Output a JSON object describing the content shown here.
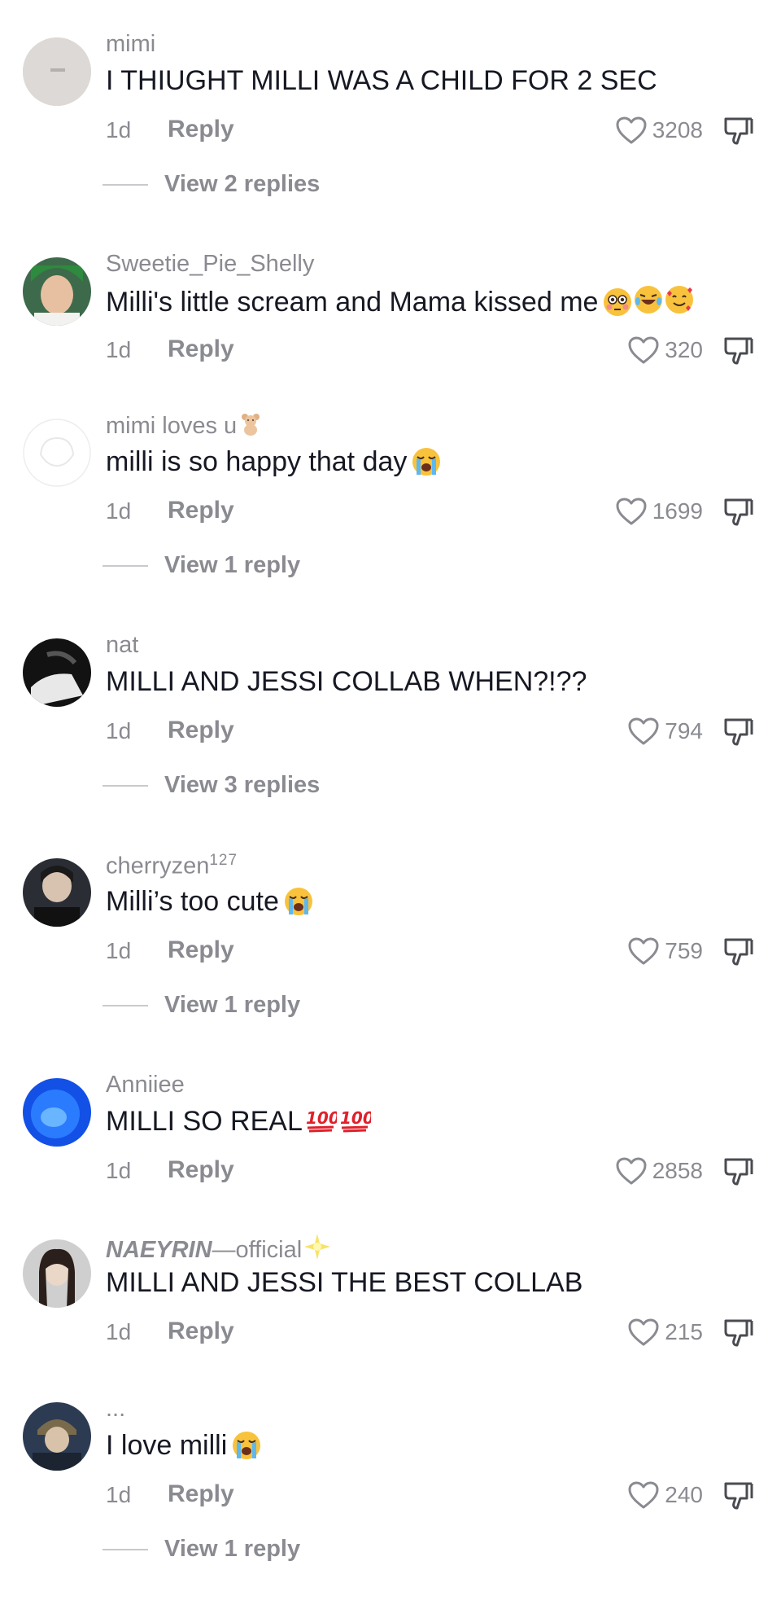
{
  "comments": [
    {
      "username": "mimi",
      "text": "I THIUGHT MILLI WAS A CHILD FOR 2 SEC",
      "date": "1d",
      "reply_label": "Reply",
      "likes": "3208",
      "view_replies": "View 2 replies"
    },
    {
      "username": "Sweetie_Pie_Shelly",
      "text": "Milli's little scream and Mama kissed me",
      "emojis": [
        "flushed-face",
        "rofl-face",
        "smiling-face-with-hearts"
      ],
      "date": "1d",
      "reply_label": "Reply",
      "likes": "320"
    },
    {
      "username": "mimi loves u",
      "username_emoji": "teddy-bear",
      "text": "milli is so happy that day",
      "emojis": [
        "loudly-crying-face"
      ],
      "date": "1d",
      "reply_label": "Reply",
      "likes": "1699",
      "view_replies": "View 1 reply"
    },
    {
      "username": "nat",
      "text": "MILLI AND JESSI COLLAB WHEN?!??",
      "date": "1d",
      "reply_label": "Reply",
      "likes": "794",
      "view_replies": "View 3 replies"
    },
    {
      "username": "cherryzen",
      "username_sup": "127",
      "text": "Milli’s too cute",
      "emojis": [
        "loudly-crying-face"
      ],
      "date": "1d",
      "reply_label": "Reply",
      "likes": "759",
      "view_replies": "View 1 reply"
    },
    {
      "username": "Anniiee",
      "text": "MILLI SO REAL",
      "emojis": [
        "hundred-points",
        "hundred-points"
      ],
      "date": "1d",
      "reply_label": "Reply",
      "likes": "2858"
    },
    {
      "username_italic": "NAEYRIN",
      "username": "—official",
      "username_emoji": "sparkle-star",
      "text": "MILLI AND JESSI THE BEST COLLAB",
      "date": "1d",
      "reply_label": "Reply",
      "likes": "215"
    },
    {
      "username": "...",
      "text": "I love milli",
      "emojis": [
        "loudly-crying-face"
      ],
      "date": "1d",
      "reply_label": "Reply",
      "likes": "240",
      "view_replies": "View 1 reply"
    }
  ],
  "icons": {
    "like": "heart-outline-icon",
    "dislike": "thumbs-down-icon"
  },
  "colors": {
    "text": "#161823",
    "muted": "#8a8b91",
    "background": "#ffffff"
  }
}
